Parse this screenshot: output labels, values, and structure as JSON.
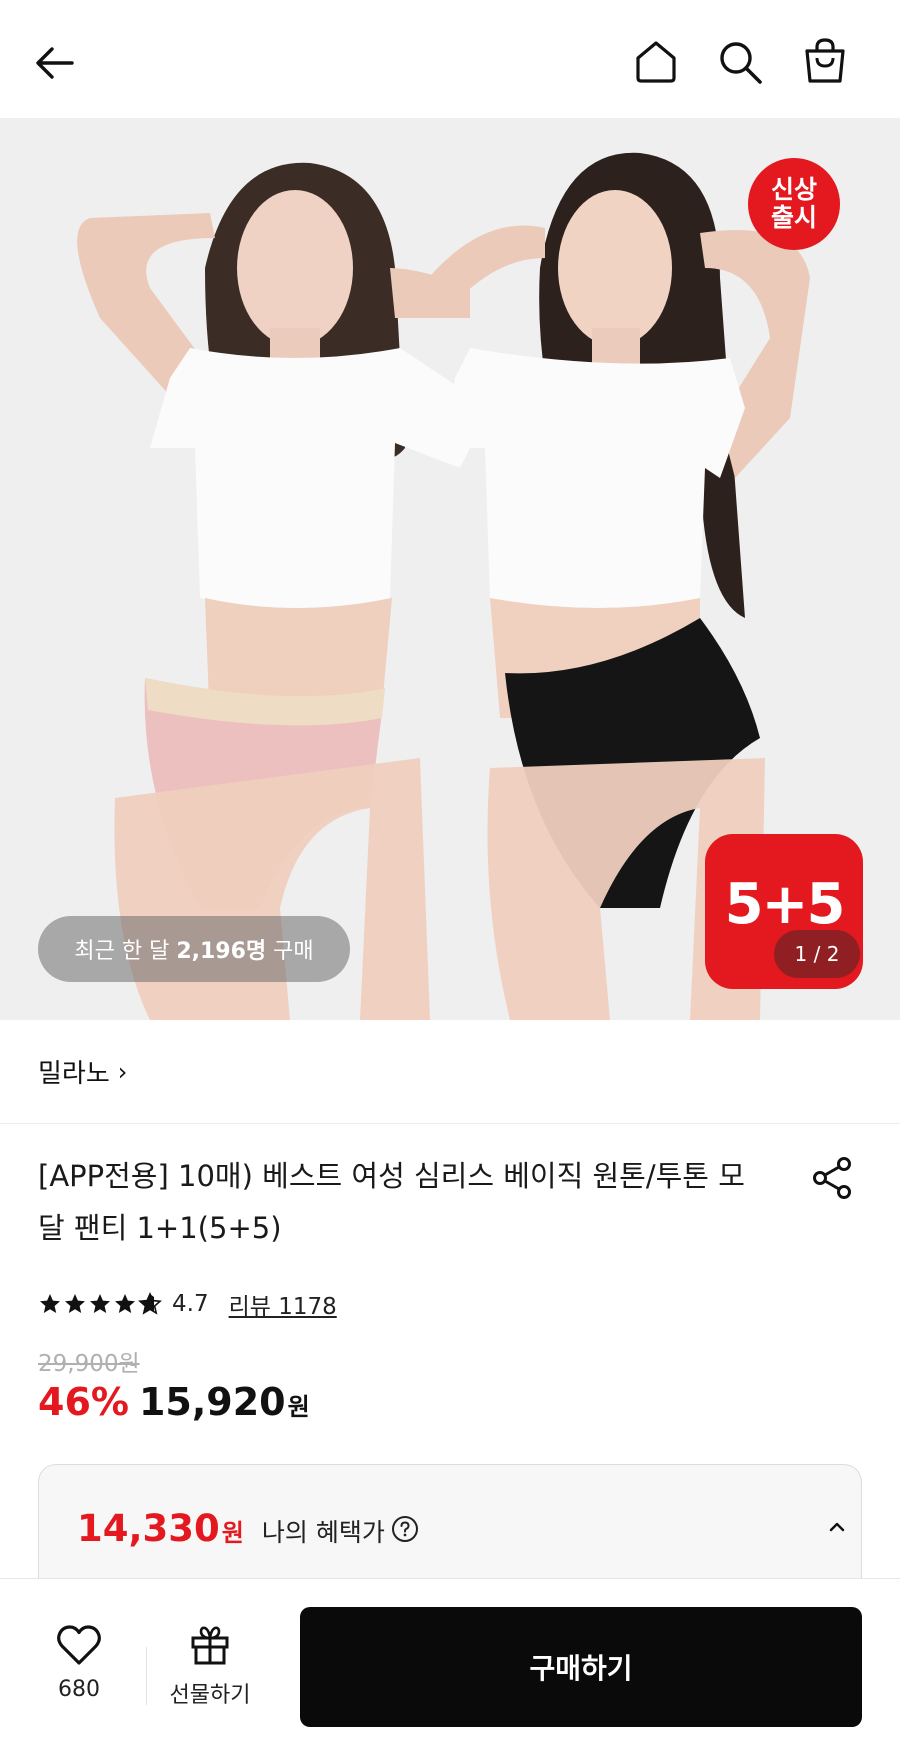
{
  "header": {
    "back_icon": "arrow-left-icon",
    "home_icon": "home-icon",
    "search_icon": "search-icon",
    "bag_icon": "shopping-bag-icon"
  },
  "hero": {
    "badge_new_line1": "신상",
    "badge_new_line2": "출시",
    "badge_set": "5+5",
    "image_counter": "1 / 2",
    "recent_prefix": "최근 한 달",
    "recent_count": "2,196명",
    "recent_suffix": "구매"
  },
  "brand": {
    "name": "밀라노",
    "chevron": "›"
  },
  "product": {
    "title": "[APP전용] 10매) 베스트 여성 심리스 베이직 원톤/투톤 모달 팬티 1+1(5+5)",
    "rating": "4.7",
    "rating_value": 4.7,
    "review_label": "리뷰 1178",
    "original_price": "29,900원",
    "discount_percent": "46%",
    "sale_price": "15,920",
    "currency": "원"
  },
  "benefit": {
    "price": "14,330",
    "currency": "원",
    "label": "나의 혜택가"
  },
  "bottom_bar": {
    "like_count": "680",
    "gift_label": "선물하기",
    "buy_label": "구매하기"
  },
  "colors": {
    "accent_red": "#e4181f",
    "buy_button": "#0a0a0a"
  }
}
